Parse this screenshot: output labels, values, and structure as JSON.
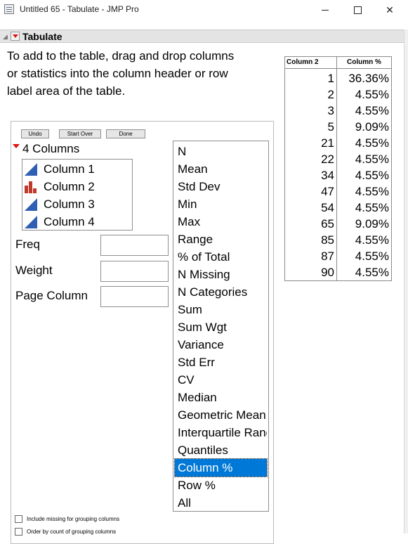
{
  "window": {
    "title": "Untitled 65 - Tabulate - JMP Pro",
    "min_icon": "minimize-icon",
    "max_icon": "maximize-icon",
    "close_symbol": "✕"
  },
  "outline": {
    "title": "Tabulate",
    "disclosure": "◢"
  },
  "instructions": "To add to the table, drag and drop columns or statistics into the column header or row label area of the table.",
  "buttons": {
    "undo": "Undo",
    "start_over": "Start Over",
    "done": "Done"
  },
  "columns_panel": {
    "label": "4 Columns",
    "items": [
      {
        "label": "Column 1",
        "icon": "continuous-icon"
      },
      {
        "label": "Column 2",
        "icon": "nominal-icon"
      },
      {
        "label": "Column 3",
        "icon": "continuous-icon"
      },
      {
        "label": "Column 4",
        "icon": "continuous-icon"
      }
    ]
  },
  "roles": {
    "freq": "Freq",
    "weight": "Weight",
    "page_column": "Page Column"
  },
  "statistics": [
    "N",
    "Mean",
    "Std Dev",
    "Min",
    "Max",
    "Range",
    "% of Total",
    "N Missing",
    "N Categories",
    "Sum",
    "Sum Wgt",
    "Variance",
    "Std Err",
    "CV",
    "Median",
    "Geometric Mean",
    "Interquartile Range",
    "Quantiles",
    "Column %",
    "Row %",
    "All"
  ],
  "selected_statistic": "Column %",
  "options": {
    "include_missing": "Include missing for grouping columns",
    "order_by_count": "Order by count of grouping columns"
  },
  "result_table": {
    "headers": [
      "Column 2",
      "Column %"
    ],
    "rows": [
      [
        "1",
        "36.36%"
      ],
      [
        "2",
        "4.55%"
      ],
      [
        "3",
        "4.55%"
      ],
      [
        "5",
        "9.09%"
      ],
      [
        "21",
        "4.55%"
      ],
      [
        "22",
        "4.55%"
      ],
      [
        "34",
        "4.55%"
      ],
      [
        "47",
        "4.55%"
      ],
      [
        "54",
        "4.55%"
      ],
      [
        "65",
        "9.09%"
      ],
      [
        "85",
        "4.55%"
      ],
      [
        "87",
        "4.55%"
      ],
      [
        "90",
        "4.55%"
      ]
    ]
  },
  "colors": {
    "selection": "#0078d7",
    "accent_red": "#d11111",
    "continuous_blue": "#2f5fb3",
    "nominal_red": "#c0392b"
  }
}
